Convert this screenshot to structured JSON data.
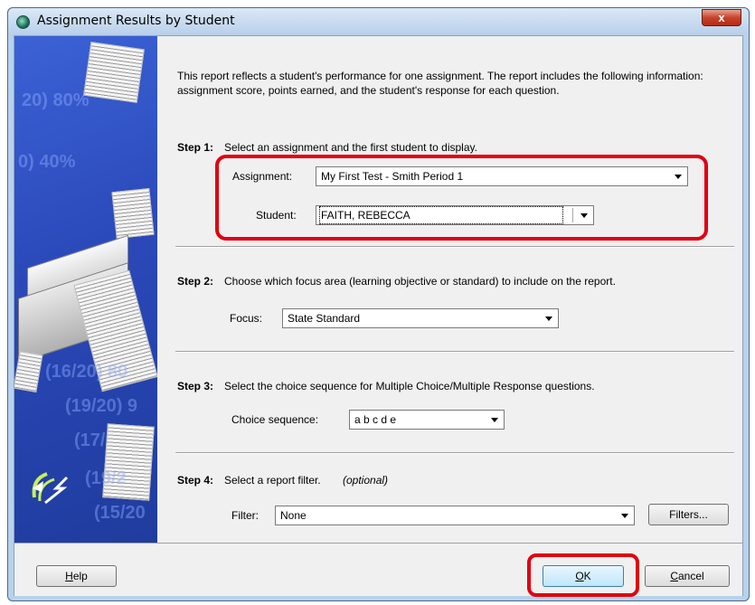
{
  "window": {
    "title": "Assignment Results by Student",
    "close_label": "x"
  },
  "intro": "This report reflects a student's performance for one assignment.  The report includes the following information: assignment score, points earned, and the student's response for each question.",
  "step1": {
    "heading": "Step 1:",
    "text": "Select an assignment and the first student to display.",
    "assignment_label": "Assignment:",
    "assignment_value": "My First Test - Smith Period 1",
    "student_label": "Student:",
    "student_value": "FAITH, REBECCA"
  },
  "step2": {
    "heading": "Step 2:",
    "text": "Choose which focus area (learning objective or standard) to include on the report.",
    "focus_label": "Focus:",
    "focus_value": "State Standard"
  },
  "step3": {
    "heading": "Step 3:",
    "text": "Select the choice sequence for Multiple Choice/Multiple Response questions.",
    "sequence_label": "Choice sequence:",
    "sequence_value": "a b c d e"
  },
  "step4": {
    "heading": "Step 4:",
    "text": "Select a report filter.",
    "optional": "(optional)",
    "filter_label": "Filter:",
    "filter_value": "None",
    "filters_button": "Filters..."
  },
  "buttons": {
    "help_u": "H",
    "help_rest": "elp",
    "ok_u": "O",
    "ok_rest": "K",
    "cancel_u": "C",
    "cancel_rest": "ancel"
  },
  "side_panel": {
    "ghost_texts": [
      "20) 80%",
      "0) 40%",
      "(19/20) 9",
      "(16/20) 80",
      "(19/20) 9",
      "(17/2",
      "(19/2",
      "(15/20"
    ]
  },
  "colors": {
    "highlight": "#e1000f",
    "panel": "#2a48b8"
  }
}
